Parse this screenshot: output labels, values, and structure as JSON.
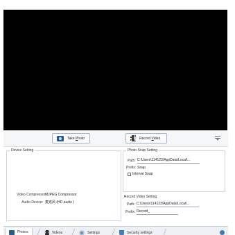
{
  "toolbar": {
    "take_photo_prefix": "Take ",
    "take_photo_access": "P",
    "take_photo_suffix": "hoto",
    "record_video_prefix": "Record ",
    "record_video_access": "V",
    "record_video_suffix": "ideo"
  },
  "device_setting": {
    "title": "Device Setting",
    "video_compressor_label": "Video Compressor:",
    "video_compressor_value": "MJPEG Compressor",
    "audio_device_label": "Audio Device:",
    "audio_device_value": "麦克风 (HD audio )"
  },
  "photo_snap": {
    "title": "Photo Snap Setting",
    "path_label": "Path:",
    "path_value": "C:\\Users\\114123\\AppData\\Local\\...",
    "prefix_label": "Prefix:",
    "prefix_value": "Snap",
    "interval_label": "Interval Snap"
  },
  "record_video": {
    "title": "Record Video Setting",
    "path_label": "Path:",
    "path_value": "C:\\Users\\114123\\AppData\\Local\\...",
    "prefix_label": "Prefix:",
    "prefix_value": "Record_"
  },
  "tabs": [
    {
      "label": "Photos"
    },
    {
      "label": "Videos"
    },
    {
      "label": "Settings"
    },
    {
      "label": "Security settings"
    }
  ],
  "colors": {
    "accent": "#3b78c8",
    "preview": "#000000"
  }
}
